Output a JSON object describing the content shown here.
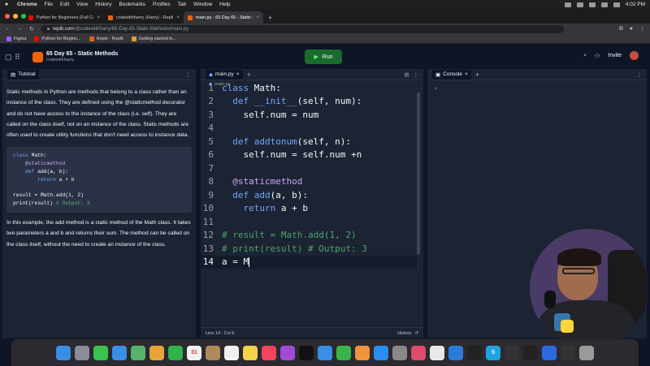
{
  "menubar": {
    "app": "Chrome",
    "items": [
      "File",
      "Edit",
      "View",
      "History",
      "Bookmarks",
      "Profiles",
      "Tab",
      "Window",
      "Help"
    ],
    "time": "4:02 PM"
  },
  "browser": {
    "tabs": [
      {
        "title": "Python for Beginners (Full Co",
        "color": "#ff0000"
      },
      {
        "title": "codewithharry (Harry) - Replit",
        "color": "#f26207"
      },
      {
        "title": "main.py - 65 Day 65 - Static M",
        "color": "#f26207",
        "active": true
      }
    ],
    "url_host": "replit.com",
    "url_path": "/@codewithharry/65-Day-65-Static-Methods#main.py",
    "bookmarks": [
      {
        "label": "Figma",
        "color": "#a259ff"
      },
      {
        "label": "Python for Beginn...",
        "color": "#ff0000"
      },
      {
        "label": "Repls - Replit",
        "color": "#f26207"
      },
      {
        "label": "Getting started in...",
        "color": "#e0a030"
      }
    ]
  },
  "replit": {
    "project_title": "65 Day 65 - Static Methods",
    "project_user": "codewithharry",
    "run_label": "Run",
    "invite_label": "Invite"
  },
  "tutorial": {
    "tab_label": "Tutorial",
    "para1": "Static methods in Python are methods that belong to a class rather than an instance of the class. They are defined using the @staticmethod decorator and do not have access to the instance of the class (i.e. self). They are called on the class itself, not on an instance of the class. Static methods are often used to create utility functions that don't need access to instance data.",
    "code": {
      "l1a": "class",
      "l1b": " Math:",
      "l2": "    @staticmethod",
      "l3a": "    def",
      "l3b": " add(a, b):",
      "l4a": "        return",
      "l4b": " a + b",
      "l5": "result = Math.add(1, 2)",
      "l6a": "print(result) ",
      "l6b": "# Output: 3"
    },
    "para2": "In this example, the add method is a static method of the Math class. It takes two parameters a and b and returns their sum. The method can be called on the class itself, without the need to create an instance of the class."
  },
  "editor": {
    "tab_label": "main.py",
    "file_path": "main.py",
    "lines": [
      {
        "n": "1",
        "parts": [
          [
            "kw",
            "class"
          ],
          [
            "",
            " Math:"
          ]
        ]
      },
      {
        "n": "2",
        "parts": [
          [
            "",
            "  "
          ],
          [
            "kw",
            "def"
          ],
          [
            "fn",
            " __init__"
          ],
          [
            "",
            "(self, num):"
          ]
        ]
      },
      {
        "n": "3",
        "parts": [
          [
            "",
            "    self.num = num"
          ]
        ]
      },
      {
        "n": "4",
        "parts": []
      },
      {
        "n": "5",
        "parts": [
          [
            "",
            "  "
          ],
          [
            "kw",
            "def"
          ],
          [
            "fn",
            " addtonum"
          ],
          [
            "",
            "(self, n):"
          ]
        ]
      },
      {
        "n": "6",
        "parts": [
          [
            "",
            "    self.num = self.num +n"
          ]
        ]
      },
      {
        "n": "7",
        "parts": []
      },
      {
        "n": "8",
        "parts": [
          [
            "",
            "  "
          ],
          [
            "dec",
            "@staticmethod"
          ]
        ]
      },
      {
        "n": "9",
        "parts": [
          [
            "",
            "  "
          ],
          [
            "kw",
            "def"
          ],
          [
            "fn",
            " add"
          ],
          [
            "",
            "(a, b):"
          ]
        ]
      },
      {
        "n": "10",
        "parts": [
          [
            "",
            "    "
          ],
          [
            "kw",
            "return"
          ],
          [
            "",
            " a + b"
          ]
        ]
      },
      {
        "n": "11",
        "parts": []
      },
      {
        "n": "12",
        "parts": [
          [
            "cm",
            "# result = Math.add(1, 2)"
          ]
        ]
      },
      {
        "n": "13",
        "parts": [
          [
            "cm",
            "# print(result) # Output: 3"
          ]
        ]
      },
      {
        "n": "14",
        "parts": [
          [
            "",
            "a = M"
          ]
        ],
        "active": true
      }
    ],
    "cursor_pos": "Line 14 : Col 6",
    "history_label": "History"
  },
  "console": {
    "tab_label": "Console",
    "prompt": "›"
  },
  "dock": {
    "apps": [
      {
        "name": "finder",
        "color": "#3a8ee6",
        "glyph": ""
      },
      {
        "name": "launchpad",
        "color": "#8a8a9a",
        "glyph": ""
      },
      {
        "name": "messages",
        "color": "#3ac34f",
        "glyph": ""
      },
      {
        "name": "mail",
        "color": "#3a8ee6",
        "glyph": ""
      },
      {
        "name": "maps",
        "color": "#56b36a",
        "glyph": ""
      },
      {
        "name": "photos",
        "color": "#e8a43a",
        "glyph": ""
      },
      {
        "name": "facetime",
        "color": "#2fb34a",
        "glyph": ""
      },
      {
        "name": "calendar",
        "color": "#f0f0f0",
        "glyph": "31"
      },
      {
        "name": "contacts",
        "color": "#b08a5a",
        "glyph": ""
      },
      {
        "name": "reminders",
        "color": "#f0f0f0",
        "glyph": ""
      },
      {
        "name": "notes",
        "color": "#f5d24a",
        "glyph": ""
      },
      {
        "name": "music",
        "color": "#f0445a",
        "glyph": ""
      },
      {
        "name": "podcasts",
        "color": "#a24ad8",
        "glyph": ""
      },
      {
        "name": "tv",
        "color": "#111111",
        "glyph": ""
      },
      {
        "name": "keynote",
        "color": "#3a8ee6",
        "glyph": ""
      },
      {
        "name": "numbers",
        "color": "#3ab34a",
        "glyph": ""
      },
      {
        "name": "pages",
        "color": "#f0943a",
        "glyph": ""
      },
      {
        "name": "app-store",
        "color": "#2a8ef0",
        "glyph": ""
      },
      {
        "name": "settings",
        "color": "#888888",
        "glyph": ""
      },
      {
        "name": "notion",
        "color": "#e04a6a",
        "glyph": ""
      },
      {
        "name": "chrome",
        "color": "#e8e8e8",
        "glyph": ""
      },
      {
        "name": "vscode",
        "color": "#2a7ad8",
        "glyph": ""
      },
      {
        "name": "terminal",
        "color": "#222222",
        "glyph": ""
      },
      {
        "name": "skype",
        "color": "#1fa3e0",
        "glyph": "S"
      },
      {
        "name": "obs",
        "color": "#333333",
        "glyph": ""
      },
      {
        "name": "app-g",
        "color": "#222222",
        "glyph": ""
      },
      {
        "name": "zoom",
        "color": "#2d6ae0",
        "glyph": ""
      },
      {
        "name": "app-dark",
        "color": "#333333",
        "glyph": ""
      },
      {
        "name": "trash",
        "color": "#9a9a9a",
        "glyph": ""
      }
    ]
  }
}
